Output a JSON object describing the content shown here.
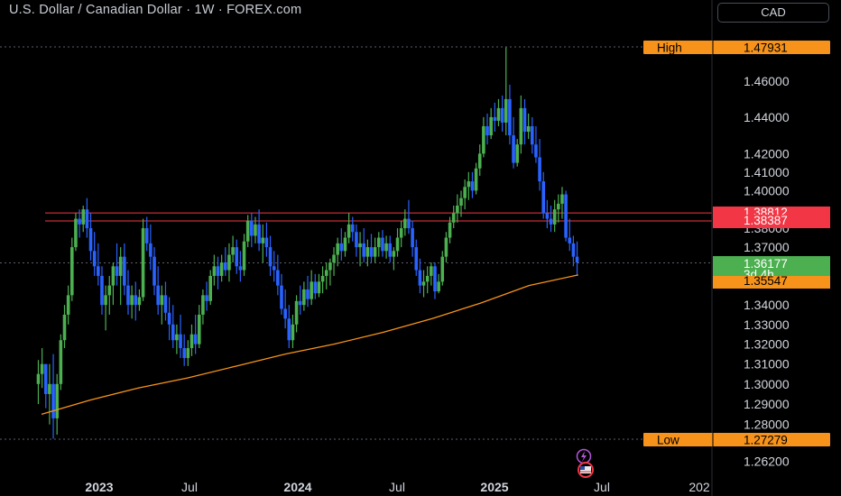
{
  "header": {
    "title": "U.S. Dollar / Canadian Dollar · 1W · FOREX.com",
    "currency": "CAD"
  },
  "colors": {
    "background": "#000000",
    "bull": "#4caf50",
    "bear": "#2962ff",
    "ma": "#f7931a",
    "resistance": "#f23645",
    "high_low_tag": "#f7931a",
    "price_tag": "#4caf50"
  },
  "icons": [
    "lightning-icon",
    "us-flag-icon"
  ],
  "chart_data": {
    "type": "candlestick",
    "title": "U.S. Dollar / Canadian Dollar · 1W · FOREX.com",
    "x_ticks": [
      "2023",
      "Jul",
      "2024",
      "Jul",
      "2025",
      "Jul",
      "202"
    ],
    "y_ticks": [
      "1.46000",
      "1.44000",
      "1.42000",
      "1.41000",
      "1.40000",
      "1.38000",
      "1.37000",
      "1.34000",
      "1.33000",
      "1.32000",
      "1.31000",
      "1.30000",
      "1.29000",
      "1.28000",
      "1.26200"
    ],
    "y_scale": "log",
    "high": {
      "label": "High",
      "value": "1.47931"
    },
    "low": {
      "label": "Low",
      "value": "1.27279"
    },
    "resistance_levels": [
      "1.38812",
      "1.38387"
    ],
    "last_price": {
      "value": "1.36177",
      "countdown": "3d 4h"
    },
    "moving_average": {
      "value": "1.35547",
      "points": [
        [
          "2022-09",
          1.285
        ],
        [
          "2022-12",
          1.292
        ],
        [
          "2023-03",
          1.298
        ],
        [
          "2023-06",
          1.303
        ],
        [
          "2023-09",
          1.309
        ],
        [
          "2023-12",
          1.315
        ],
        [
          "2024-03",
          1.32
        ],
        [
          "2024-06",
          1.326
        ],
        [
          "2024-09",
          1.333
        ],
        [
          "2024-12",
          1.341
        ],
        [
          "2025-03",
          1.35
        ],
        [
          "2025-06",
          1.3555
        ]
      ]
    },
    "candles": [
      [
        "2022-09-09",
        1.3,
        1.312,
        1.29,
        1.305
      ],
      [
        "2022-09-16",
        1.305,
        1.318,
        1.298,
        1.31
      ],
      [
        "2022-09-23",
        1.31,
        1.3,
        1.288,
        1.295
      ],
      [
        "2022-09-30",
        1.295,
        1.31,
        1.28,
        1.3
      ],
      [
        "2022-10-07",
        1.3,
        1.315,
        1.273,
        1.283
      ],
      [
        "2022-10-14",
        1.283,
        1.305,
        1.275,
        1.3
      ],
      [
        "2022-10-21",
        1.3,
        1.325,
        1.297,
        1.322
      ],
      [
        "2022-10-28",
        1.322,
        1.34,
        1.318,
        1.335
      ],
      [
        "2022-11-04",
        1.335,
        1.35,
        1.33,
        1.345
      ],
      [
        "2022-11-11",
        1.345,
        1.375,
        1.342,
        1.37
      ],
      [
        "2022-11-18",
        1.37,
        1.388,
        1.368,
        1.385
      ],
      [
        "2022-11-25",
        1.385,
        1.39,
        1.375,
        1.382
      ],
      [
        "2022-12-02",
        1.382,
        1.392,
        1.378,
        1.39
      ],
      [
        "2022-12-09",
        1.39,
        1.396,
        1.375,
        1.38
      ],
      [
        "2022-12-16",
        1.38,
        1.388,
        1.363,
        1.368
      ],
      [
        "2022-12-23",
        1.368,
        1.378,
        1.355,
        1.36
      ],
      [
        "2022-12-30",
        1.36,
        1.372,
        1.35,
        1.355
      ],
      [
        "2023-01-06",
        1.355,
        1.36,
        1.335,
        1.34
      ],
      [
        "2023-01-13",
        1.34,
        1.35,
        1.327,
        1.345
      ],
      [
        "2023-01-20",
        1.345,
        1.355,
        1.335,
        1.35
      ],
      [
        "2023-01-27",
        1.35,
        1.362,
        1.34,
        1.36
      ],
      [
        "2023-02-03",
        1.36,
        1.372,
        1.35,
        1.355
      ],
      [
        "2023-02-10",
        1.355,
        1.37,
        1.34,
        1.365
      ],
      [
        "2023-02-17",
        1.365,
        1.372,
        1.345,
        1.35
      ],
      [
        "2023-02-24",
        1.35,
        1.358,
        1.335,
        1.34
      ],
      [
        "2023-03-03",
        1.34,
        1.35,
        1.333,
        1.345
      ],
      [
        "2023-03-10",
        1.345,
        1.352,
        1.332,
        1.34
      ],
      [
        "2023-03-17",
        1.34,
        1.348,
        1.337,
        1.344
      ],
      [
        "2023-03-24",
        1.344,
        1.385,
        1.342,
        1.38
      ],
      [
        "2023-03-31",
        1.38,
        1.386,
        1.368,
        1.372
      ],
      [
        "2023-04-07",
        1.372,
        1.382,
        1.358,
        1.365
      ],
      [
        "2023-04-14",
        1.365,
        1.37,
        1.345,
        1.35
      ],
      [
        "2023-04-21",
        1.35,
        1.36,
        1.335,
        1.34
      ],
      [
        "2023-04-28",
        1.34,
        1.35,
        1.33,
        1.345
      ],
      [
        "2023-05-05",
        1.345,
        1.352,
        1.332,
        1.336
      ],
      [
        "2023-05-12",
        1.336,
        1.344,
        1.322,
        1.33
      ],
      [
        "2023-05-19",
        1.33,
        1.34,
        1.318,
        1.322
      ],
      [
        "2023-05-26",
        1.322,
        1.33,
        1.315,
        1.325
      ],
      [
        "2023-06-02",
        1.325,
        1.335,
        1.313,
        1.318
      ],
      [
        "2023-06-09",
        1.318,
        1.325,
        1.309,
        1.313
      ],
      [
        "2023-06-16",
        1.313,
        1.322,
        1.309,
        1.318
      ],
      [
        "2023-06-23",
        1.318,
        1.33,
        1.314,
        1.325
      ],
      [
        "2023-06-30",
        1.325,
        1.335,
        1.315,
        1.32
      ],
      [
        "2023-07-07",
        1.32,
        1.34,
        1.318,
        1.335
      ],
      [
        "2023-07-14",
        1.335,
        1.348,
        1.33,
        1.345
      ],
      [
        "2023-07-21",
        1.345,
        1.352,
        1.337,
        1.342
      ],
      [
        "2023-07-28",
        1.342,
        1.358,
        1.34,
        1.355
      ],
      [
        "2023-08-04",
        1.355,
        1.366,
        1.35,
        1.36
      ],
      [
        "2023-08-11",
        1.36,
        1.365,
        1.348,
        1.355
      ],
      [
        "2023-08-18",
        1.355,
        1.366,
        1.352,
        1.362
      ],
      [
        "2023-08-25",
        1.362,
        1.37,
        1.355,
        1.358
      ],
      [
        "2023-09-01",
        1.358,
        1.372,
        1.352,
        1.366
      ],
      [
        "2023-09-08",
        1.366,
        1.376,
        1.362,
        1.37
      ],
      [
        "2023-09-15",
        1.37,
        1.374,
        1.356,
        1.36
      ],
      [
        "2023-09-22",
        1.36,
        1.368,
        1.352,
        1.358
      ],
      [
        "2023-09-29",
        1.358,
        1.377,
        1.355,
        1.373
      ],
      [
        "2023-10-06",
        1.373,
        1.387,
        1.37,
        1.384
      ],
      [
        "2023-10-13",
        1.384,
        1.388,
        1.37,
        1.376
      ],
      [
        "2023-10-20",
        1.376,
        1.386,
        1.372,
        1.382
      ],
      [
        "2023-10-27",
        1.382,
        1.39,
        1.368,
        1.372
      ],
      [
        "2023-11-03",
        1.372,
        1.382,
        1.362,
        1.375
      ],
      [
        "2023-11-10",
        1.375,
        1.383,
        1.365,
        1.37
      ],
      [
        "2023-11-17",
        1.37,
        1.376,
        1.355,
        1.36
      ],
      [
        "2023-11-24",
        1.36,
        1.368,
        1.352,
        1.358
      ],
      [
        "2023-12-01",
        1.358,
        1.366,
        1.345,
        1.35
      ],
      [
        "2023-12-08",
        1.35,
        1.356,
        1.335,
        1.338
      ],
      [
        "2023-12-15",
        1.338,
        1.348,
        1.328,
        1.333
      ],
      [
        "2023-12-22",
        1.333,
        1.34,
        1.318,
        1.322
      ],
      [
        "2023-12-29",
        1.322,
        1.335,
        1.318,
        1.33
      ],
      [
        "2024-01-05",
        1.33,
        1.345,
        1.326,
        1.342
      ],
      [
        "2024-01-12",
        1.342,
        1.35,
        1.335,
        1.34
      ],
      [
        "2024-01-19",
        1.34,
        1.352,
        1.337,
        1.348
      ],
      [
        "2024-01-26",
        1.348,
        1.355,
        1.339,
        1.343
      ],
      [
        "2024-02-02",
        1.343,
        1.358,
        1.34,
        1.352
      ],
      [
        "2024-02-09",
        1.352,
        1.356,
        1.343,
        1.346
      ],
      [
        "2024-02-16",
        1.346,
        1.356,
        1.344,
        1.352
      ],
      [
        "2024-02-23",
        1.352,
        1.36,
        1.346,
        1.355
      ],
      [
        "2024-03-01",
        1.355,
        1.362,
        1.348,
        1.358
      ],
      [
        "2024-03-08",
        1.358,
        1.364,
        1.35,
        1.362
      ],
      [
        "2024-03-15",
        1.362,
        1.37,
        1.355,
        1.366
      ],
      [
        "2024-03-22",
        1.366,
        1.375,
        1.36,
        1.372
      ],
      [
        "2024-03-29",
        1.372,
        1.38,
        1.363,
        1.368
      ],
      [
        "2024-04-05",
        1.368,
        1.378,
        1.365,
        1.375
      ],
      [
        "2024-04-12",
        1.375,
        1.388,
        1.372,
        1.382
      ],
      [
        "2024-04-19",
        1.382,
        1.386,
        1.373,
        1.378
      ],
      [
        "2024-04-26",
        1.378,
        1.382,
        1.365,
        1.37
      ],
      [
        "2024-05-03",
        1.37,
        1.378,
        1.36,
        1.372
      ],
      [
        "2024-05-10",
        1.372,
        1.38,
        1.362,
        1.365
      ],
      [
        "2024-05-17",
        1.365,
        1.374,
        1.36,
        1.37
      ],
      [
        "2024-05-24",
        1.37,
        1.377,
        1.362,
        1.365
      ],
      [
        "2024-05-31",
        1.365,
        1.375,
        1.362,
        1.37
      ],
      [
        "2024-06-07",
        1.37,
        1.378,
        1.365,
        1.375
      ],
      [
        "2024-06-14",
        1.375,
        1.379,
        1.365,
        1.368
      ],
      [
        "2024-06-21",
        1.368,
        1.376,
        1.364,
        1.372
      ],
      [
        "2024-06-28",
        1.372,
        1.376,
        1.362,
        1.365
      ],
      [
        "2024-07-05",
        1.365,
        1.37,
        1.358,
        1.368
      ],
      [
        "2024-07-12",
        1.368,
        1.38,
        1.365,
        1.375
      ],
      [
        "2024-07-19",
        1.375,
        1.384,
        1.37,
        1.38
      ],
      [
        "2024-07-26",
        1.38,
        1.39,
        1.376,
        1.385
      ],
      [
        "2024-08-02",
        1.385,
        1.395,
        1.377,
        1.38
      ],
      [
        "2024-08-09",
        1.38,
        1.384,
        1.365,
        1.37
      ],
      [
        "2024-08-16",
        1.37,
        1.374,
        1.355,
        1.358
      ],
      [
        "2024-08-23",
        1.358,
        1.364,
        1.346,
        1.35
      ],
      [
        "2024-08-30",
        1.35,
        1.358,
        1.344,
        1.352
      ],
      [
        "2024-09-06",
        1.352,
        1.36,
        1.346,
        1.355
      ],
      [
        "2024-09-13",
        1.355,
        1.362,
        1.35,
        1.36
      ],
      [
        "2024-09-20",
        1.36,
        1.362,
        1.343,
        1.347
      ],
      [
        "2024-09-27",
        1.347,
        1.356,
        1.346,
        1.352
      ],
      [
        "2024-10-04",
        1.352,
        1.368,
        1.35,
        1.365
      ],
      [
        "2024-10-11",
        1.365,
        1.378,
        1.362,
        1.375
      ],
      [
        "2024-10-18",
        1.375,
        1.386,
        1.372,
        1.383
      ],
      [
        "2024-10-25",
        1.383,
        1.392,
        1.38,
        1.388
      ],
      [
        "2024-11-01",
        1.388,
        1.398,
        1.383,
        1.392
      ],
      [
        "2024-11-08",
        1.392,
        1.4,
        1.386,
        1.396
      ],
      [
        "2024-11-15",
        1.396,
        1.406,
        1.39,
        1.402
      ],
      [
        "2024-11-22",
        1.402,
        1.41,
        1.395,
        1.405
      ],
      [
        "2024-11-29",
        1.405,
        1.41,
        1.396,
        1.4
      ],
      [
        "2024-12-06",
        1.4,
        1.415,
        1.398,
        1.412
      ],
      [
        "2024-12-13",
        1.412,
        1.425,
        1.408,
        1.42
      ],
      [
        "2024-12-20",
        1.42,
        1.44,
        1.418,
        1.435
      ],
      [
        "2024-12-27",
        1.435,
        1.442,
        1.425,
        1.43
      ],
      [
        "2025-01-03",
        1.43,
        1.445,
        1.428,
        1.44
      ],
      [
        "2025-01-10",
        1.44,
        1.448,
        1.432,
        1.438
      ],
      [
        "2025-01-17",
        1.438,
        1.45,
        1.435,
        1.445
      ],
      [
        "2025-01-24",
        1.445,
        1.452,
        1.432,
        1.437
      ],
      [
        "2025-01-31",
        1.437,
        1.479,
        1.43,
        1.45
      ],
      [
        "2025-02-07",
        1.45,
        1.458,
        1.425,
        1.43
      ],
      [
        "2025-02-14",
        1.43,
        1.44,
        1.412,
        1.415
      ],
      [
        "2025-02-21",
        1.415,
        1.428,
        1.413,
        1.425
      ],
      [
        "2025-02-28",
        1.425,
        1.452,
        1.42,
        1.445
      ],
      [
        "2025-03-07",
        1.445,
        1.45,
        1.425,
        1.432
      ],
      [
        "2025-03-14",
        1.432,
        1.442,
        1.428,
        1.435
      ],
      [
        "2025-03-21",
        1.435,
        1.44,
        1.42,
        1.425
      ],
      [
        "2025-03-28",
        1.425,
        1.435,
        1.415,
        1.418
      ],
      [
        "2025-04-04",
        1.418,
        1.428,
        1.4,
        1.405
      ],
      [
        "2025-04-11",
        1.405,
        1.41,
        1.385,
        1.388
      ],
      [
        "2025-04-18",
        1.388,
        1.395,
        1.38,
        1.385
      ],
      [
        "2025-04-25",
        1.385,
        1.392,
        1.378,
        1.382
      ],
      [
        "2025-05-02",
        1.382,
        1.395,
        1.378,
        1.39
      ],
      [
        "2025-05-09",
        1.39,
        1.398,
        1.383,
        1.393
      ],
      [
        "2025-05-16",
        1.393,
        1.402,
        1.385,
        1.398
      ],
      [
        "2025-05-23",
        1.398,
        1.4,
        1.373,
        1.375
      ],
      [
        "2025-05-30",
        1.375,
        1.385,
        1.368,
        1.372
      ],
      [
        "2025-06-06",
        1.372,
        1.376,
        1.36,
        1.365
      ],
      [
        "2025-06-13",
        1.365,
        1.373,
        1.355,
        1.362
      ]
    ]
  }
}
